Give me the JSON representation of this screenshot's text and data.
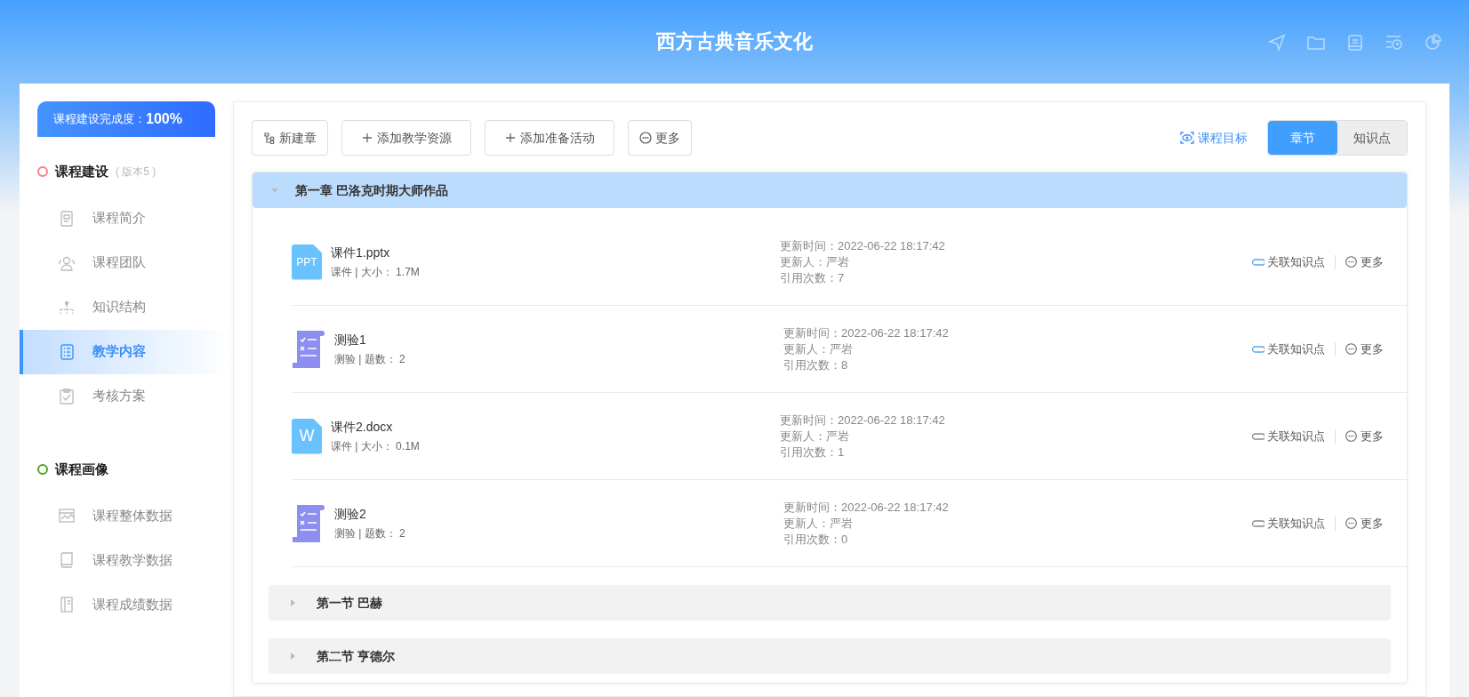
{
  "header": {
    "title": "西方古典音乐文化"
  },
  "sidebar": {
    "completion": {
      "label": "课程建设完成度：",
      "value": "100%"
    },
    "groups": [
      {
        "title": "课程建设",
        "note": "( 版本5 )",
        "color": "#f5808a",
        "items": [
          {
            "label": "课程简介",
            "kind": "doc",
            "selected": false
          },
          {
            "label": "课程团队",
            "kind": "team",
            "selected": false
          },
          {
            "label": "知识结构",
            "kind": "tree",
            "selected": false
          },
          {
            "label": "教学内容",
            "kind": "list",
            "selected": true
          },
          {
            "label": "考核方案",
            "kind": "check",
            "selected": false
          }
        ]
      },
      {
        "title": "课程画像",
        "color": "#52a41a",
        "items": [
          {
            "label": "课程整体数据",
            "kind": "chart",
            "selected": false
          },
          {
            "label": "课程教学数据",
            "kind": "book",
            "selected": false
          },
          {
            "label": "课程成绩数据",
            "kind": "ledger",
            "selected": false
          }
        ]
      }
    ]
  },
  "toolbar": {
    "buttons": [
      {
        "label": "新建章",
        "kind": "tree"
      },
      {
        "label": "添加教学资源",
        "kind": "plus"
      },
      {
        "label": "添加准备活动",
        "kind": "plus"
      },
      {
        "label": "更多",
        "kind": "more"
      }
    ],
    "goal_link": "课程目标",
    "view_tabs": [
      {
        "label": "章节",
        "selected": true
      },
      {
        "label": "知识点",
        "selected": false
      }
    ]
  },
  "chapters": [
    {
      "title": "第一章 巴洛克时期大师作品",
      "expanded": true,
      "resources": [
        {
          "kind": "ppt",
          "icon_text": "PPT",
          "name": "课件1.pptx",
          "meta": "课件 | 大小： 1.7M",
          "updated": "更新时间：2022-06-22 18:17:42",
          "updater": "更新人：严岩",
          "refs": "引用次数：7",
          "linked": true,
          "link_label": "关联知识点",
          "more_label": "更多"
        },
        {
          "kind": "quiz",
          "name": "测验1",
          "meta": "测验 | 题数： 2",
          "updated": "更新时间：2022-06-22 18:17:42",
          "updater": "更新人：严岩",
          "refs": "引用次数：8",
          "linked": true,
          "link_label": "关联知识点",
          "more_label": "更多"
        },
        {
          "kind": "word",
          "icon_text": "W",
          "name": "课件2.docx",
          "meta": "课件 | 大小： 0.1M",
          "updated": "更新时间：2022-06-22 18:17:42",
          "updater": "更新人：严岩",
          "refs": "引用次数：1",
          "linked": false,
          "link_label": "关联知识点",
          "more_label": "更多"
        },
        {
          "kind": "quiz",
          "name": "测验2",
          "meta": "测验 | 题数： 2",
          "updated": "更新时间：2022-06-22 18:17:42",
          "updater": "更新人：严岩",
          "refs": "引用次数：0",
          "linked": false,
          "link_label": "关联知识点",
          "more_label": "更多"
        }
      ],
      "sections": [
        {
          "title": "第一节 巴赫",
          "expanded": false
        },
        {
          "title": "第二节 亨德尔",
          "expanded": false
        }
      ]
    }
  ]
}
